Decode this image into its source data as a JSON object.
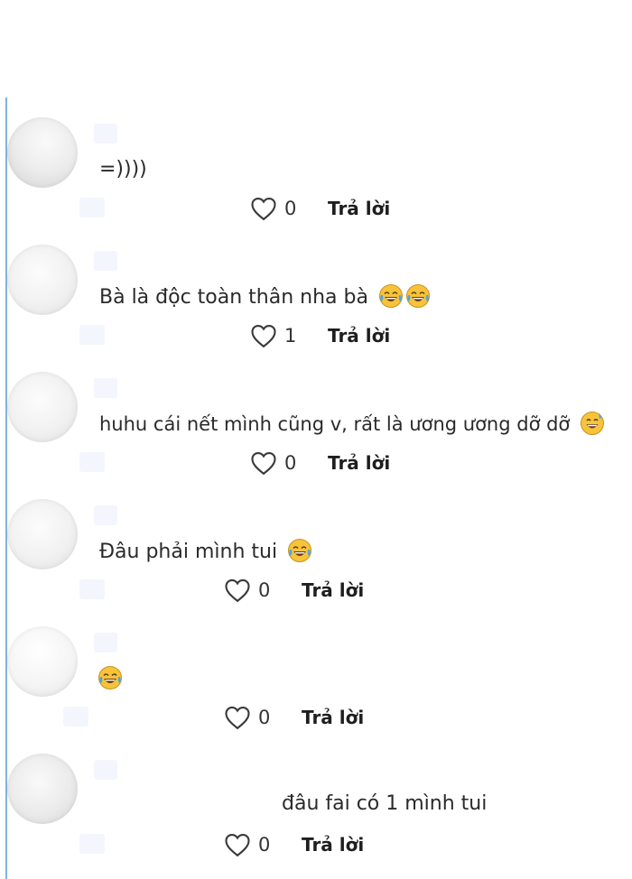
{
  "comments": [
    {
      "text": "=))))",
      "emojis": [],
      "likes": "0",
      "reply_label": "Trả lời"
    },
    {
      "text": "Bà là độc toàn thân nha bà",
      "emojis": [
        "face-with-tears-of-joy-icon",
        "face-with-tears-of-joy-icon"
      ],
      "likes": "1",
      "reply_label": "Trả lời"
    },
    {
      "text": "huhu cái nết mình cũng v, rất là ương ương dỡ dỡ",
      "emojis": [
        "grinning-face-with-sweat-icon"
      ],
      "likes": "0",
      "reply_label": "Trả lời"
    },
    {
      "text": "Đâu phải mình tui",
      "emojis": [
        "face-with-tears-of-joy-icon"
      ],
      "likes": "0",
      "reply_label": "Trả lời"
    },
    {
      "text": "",
      "emojis": [
        "face-with-tears-of-joy-icon"
      ],
      "likes": "0",
      "reply_label": "Trả lời"
    },
    {
      "text": "đâu fai có 1 mình tui",
      "emojis": [],
      "likes": "0",
      "reply_label": "Trả lời"
    }
  ],
  "colors": {
    "accent_rule": "#7fb2e0",
    "emoji_face": "#f7c33b",
    "emoji_tears": "#4aa6e8"
  }
}
